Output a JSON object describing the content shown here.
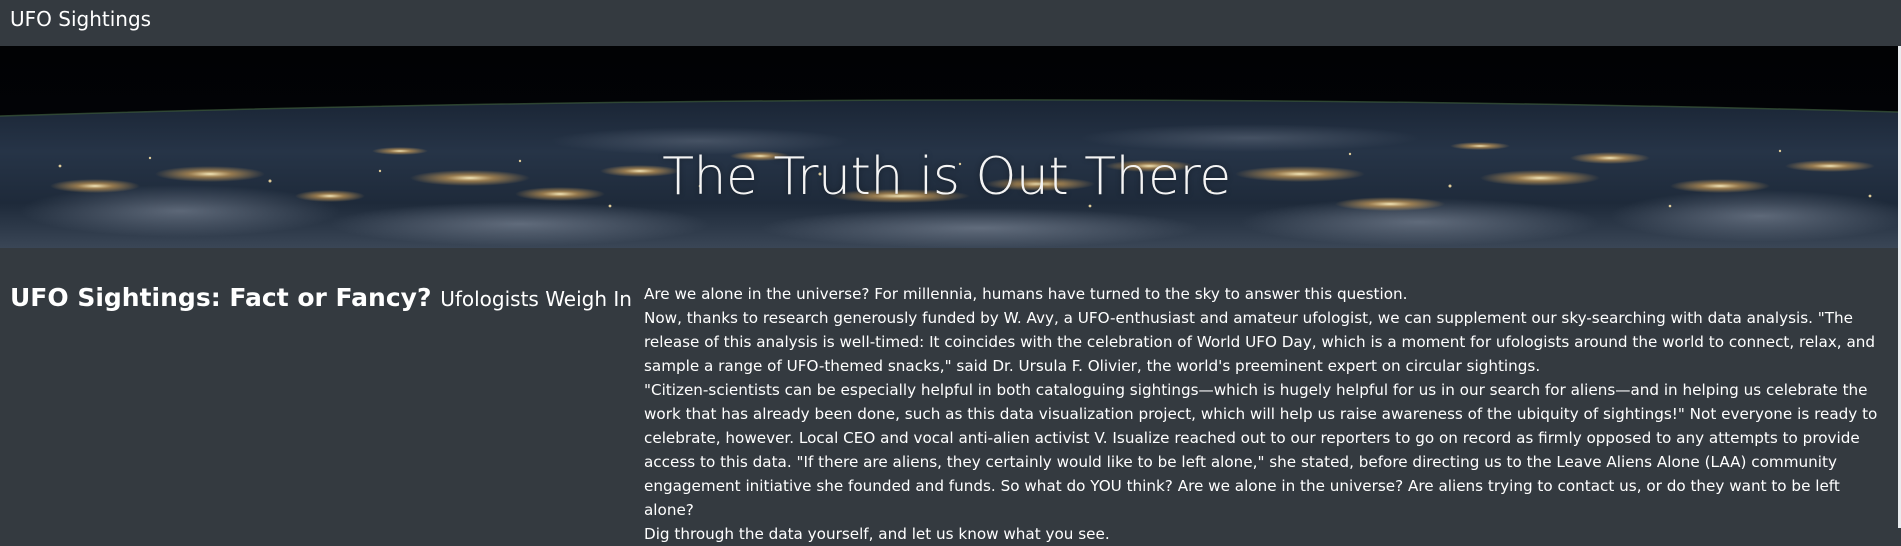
{
  "navbar": {
    "brand": "UFO Sightings"
  },
  "hero": {
    "title": "The Truth is Out There"
  },
  "article": {
    "heading": "UFO Sightings: Fact or Fancy?",
    "subheading": "Ufologists Weigh In",
    "paragraphs": [
      "Are we alone in the universe? For millennia, humans have turned to the sky to answer this question.",
      "Now, thanks to research generously funded by W. Avy, a UFO-enthusiast and amateur ufologist, we can supplement our sky-searching with data analysis. \"The release of this analysis is well-timed: It coincides with the celebration of World UFO Day, which is a moment for ufologists around the world to connect, relax, and sample a range of UFO-themed snacks,\" said Dr. Ursula F. Olivier, the world's preeminent expert on circular sightings.",
      "\"Citizen-scientists can be especially helpful in both cataloguing sightings—which is hugely helpful for us in our search for aliens—and in helping us celebrate the work that has already been done, such as this data visualization project, which will help us raise awareness of the ubiquity of sightings!\" Not everyone is ready to celebrate, however. Local CEO and vocal anti-alien activist V. Isualize reached out to our reporters to go on record as firmly opposed to any attempts to provide access to this data. \"If there are aliens, they certainly would like to be left alone,\" she stated, before directing us to the Leave Aliens Alone (LAA) community engagement initiative she founded and funds. So what do YOU think? Are we alone in the universe? Are aliens trying to contact us, or do they want to be left alone?",
      "Dig through the data yourself, and let us know what you see."
    ]
  },
  "colors": {
    "page_background": "#343a40",
    "hero_background": "#020306",
    "text": "#ffffff"
  },
  "icons": {
    "hero_image": "earth-at-night-image"
  }
}
